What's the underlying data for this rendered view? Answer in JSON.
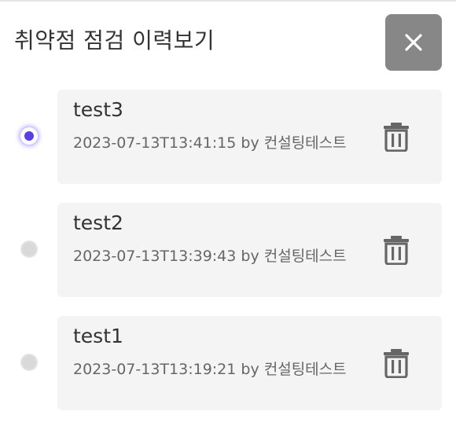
{
  "dialog": {
    "title": "취약점 점검 이력보기",
    "close_icon": "close-icon"
  },
  "history": {
    "items": [
      {
        "name": "test3",
        "meta": "2023-07-13T13:41:15 by 컨설팅테스트",
        "selected": true,
        "delete_icon": "trash-icon"
      },
      {
        "name": "test2",
        "meta": "2023-07-13T13:39:43 by 컨설팅테스트",
        "selected": false,
        "delete_icon": "trash-icon"
      },
      {
        "name": "test1",
        "meta": "2023-07-13T13:19:21 by 컨설팅테스트",
        "selected": false,
        "delete_icon": "trash-icon"
      }
    ]
  },
  "colors": {
    "close_button_bg": "#878787",
    "card_bg": "#f4f4f4",
    "radio_selected": "#5a3fe0",
    "radio_unselected": "#d9d9d9",
    "icon": "#666666"
  }
}
